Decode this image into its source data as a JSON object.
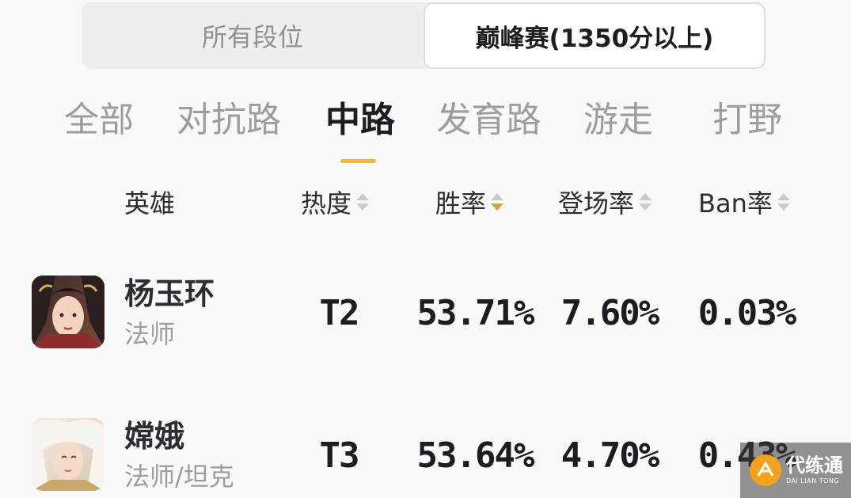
{
  "rank_segment": {
    "options": [
      "所有段位",
      "巅峰赛(1350分以上)"
    ],
    "selected": "巅峰赛(1350分以上)"
  },
  "lane_tabs": {
    "items": [
      "全部",
      "对抗路",
      "中路",
      "发育路",
      "游走",
      "打野"
    ],
    "selected": "中路"
  },
  "columns": {
    "hero": "英雄",
    "heat": "热度",
    "win_rate": "胜率",
    "pick_rate": "登场率",
    "ban_rate": "Ban率",
    "active_sort": "win_rate",
    "sort_direction": "desc"
  },
  "heroes": [
    {
      "name": "杨玉环",
      "role": "法师",
      "tier": "T2",
      "win_rate": "53.71%",
      "pick_rate": "7.60%",
      "ban_rate": "0.03%",
      "avatar": "hero-portrait"
    },
    {
      "name": "嫦娥",
      "role": "法师/坦克",
      "tier": "T3",
      "win_rate": "53.64%",
      "pick_rate": "4.70%",
      "ban_rate": "0.43%",
      "avatar": "hero-portrait"
    }
  ],
  "watermark": {
    "main": "代练通",
    "sub": "DAI LIAN TONG"
  },
  "colors": {
    "accent": "#f0b63e",
    "sort_active": "#d2a23e",
    "text_primary": "#1a1d21",
    "text_muted": "#9a9da2",
    "background": "#f8f9fa"
  }
}
